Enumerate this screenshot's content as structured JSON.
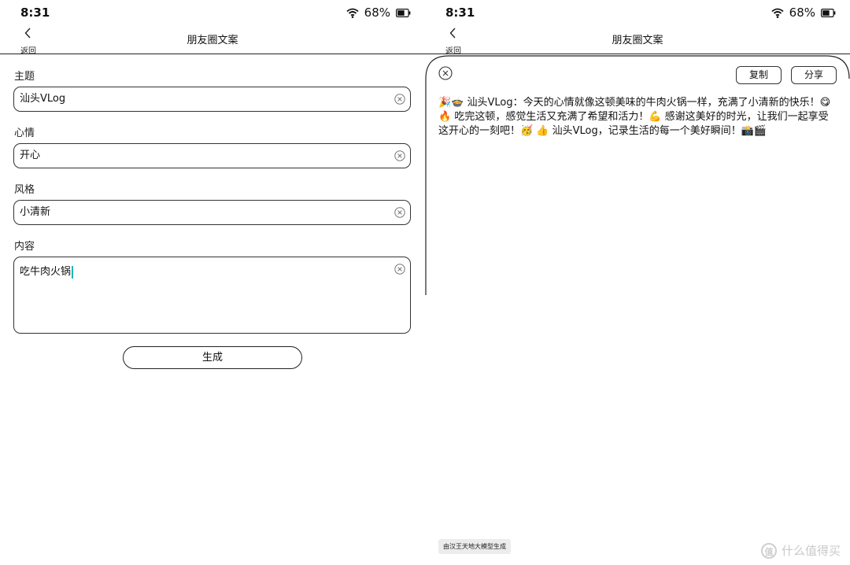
{
  "left": {
    "status": {
      "time": "8:31",
      "battery": "68%"
    },
    "nav": {
      "back_label": "返回",
      "title": "朋友圈文案"
    },
    "form": {
      "topic": {
        "label": "主题",
        "value": "汕头VLog"
      },
      "mood": {
        "label": "心情",
        "value": "开心"
      },
      "style": {
        "label": "风格",
        "value": "小清新"
      },
      "content": {
        "label": "内容",
        "value": "吃牛肉火锅"
      },
      "generate_label": "生成"
    }
  },
  "right": {
    "status": {
      "time": "8:31",
      "battery": "68%"
    },
    "nav": {
      "back_label": "返回",
      "title": "朋友圈文案"
    },
    "sheet": {
      "copy_label": "复制",
      "share_label": "分享",
      "result_text": "🎉🍲 汕头VLog：今天的心情就像这顿美味的牛肉火锅一样，充满了小清新的快乐！😋🔥 吃完这顿，感觉生活又充满了希望和活力！💪 感谢这美好的时光，让我们一起享受这开心的一刻吧！🥳 👍 汕头VLog，记录生活的每一个美好瞬间！📸🎬",
      "footer": "由汉王天地大模型生成"
    }
  },
  "watermark": {
    "logo": "值",
    "text": "什么值得买"
  },
  "icons": [
    "back-arrow-icon",
    "wifi-icon",
    "battery-icon",
    "clear-icon",
    "close-icon"
  ]
}
